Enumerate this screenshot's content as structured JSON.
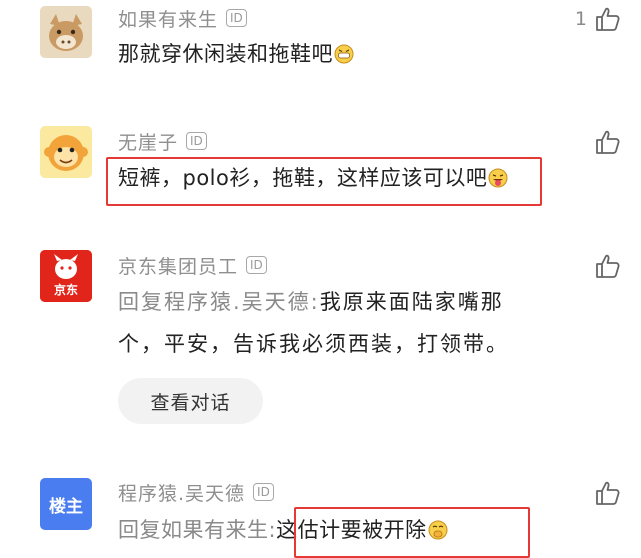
{
  "comments": [
    {
      "name": "如果有来生",
      "id_badge": "ID",
      "text": "那就穿休闲装和拖鞋吧",
      "likes": "1",
      "emoji": "grinning-face-emoji"
    },
    {
      "name": "无崖子",
      "id_badge": "ID",
      "text": "短裤，polo衫，拖鞋，这样应该可以吧",
      "emoji": "tongue-face-emoji"
    },
    {
      "name": "京东集团员工",
      "id_badge": "ID",
      "avatar_text": "京东",
      "reply_prefix": "回复程序猿.吴天德:",
      "text": "我原来面陆家嘴那个，平安，告诉我必须西装，打领带。",
      "view_conversation": "查看对话"
    },
    {
      "name": "程序猿.吴天德",
      "id_badge": "ID",
      "avatar_text": "楼主",
      "reply_prefix": "回复如果有来生:",
      "text": "这估计要被开除",
      "emoji": "hand-over-mouth-emoji"
    }
  ],
  "colors": {
    "highlight_box": "#e53935",
    "louzhu_badge": "#4a7df0",
    "jd_red": "#e1251b"
  },
  "icons": [
    "thumbs-up-icon",
    "id-badge"
  ]
}
